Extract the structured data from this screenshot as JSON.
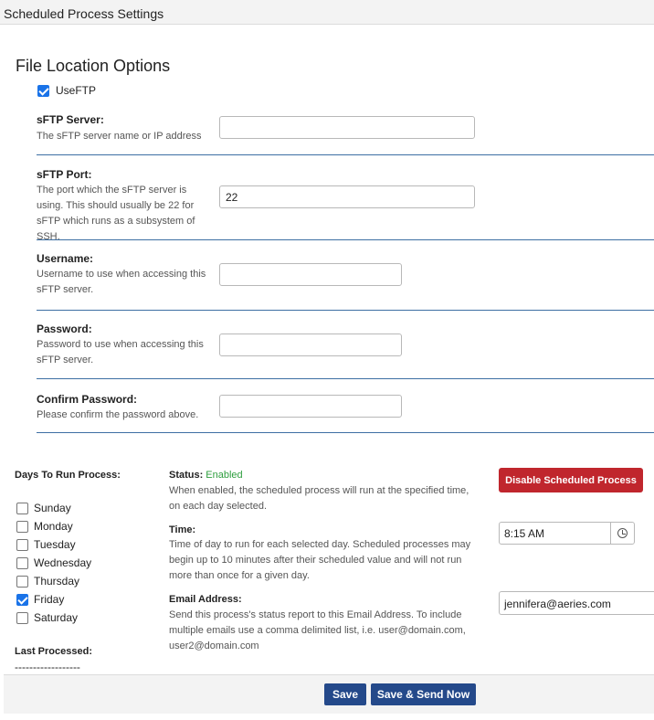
{
  "window": {
    "title": "Scheduled Process Settings"
  },
  "file_location": {
    "heading": "File Location Options",
    "use_ftp": {
      "label": "UseFTP",
      "checked": true
    },
    "fields": [
      {
        "label": "sFTP Server:",
        "description": "The sFTP server name or IP address",
        "value": ""
      },
      {
        "label": "sFTP Port:",
        "description": "The port which the sFTP server is using. This should usually be 22 for sFTP which runs as a subsystem of SSH.",
        "value": "22"
      },
      {
        "label": "Username:",
        "description": "Username to use when accessing this sFTP server.",
        "value": ""
      },
      {
        "label": "Password:",
        "description": "Password to use when accessing this sFTP server.",
        "value": ""
      },
      {
        "label": "Confirm Password:",
        "description": "Please confirm the password above.",
        "value": ""
      }
    ]
  },
  "schedule": {
    "days_title": "Days To Run Process:",
    "days": [
      {
        "label": "Sunday",
        "checked": false
      },
      {
        "label": "Monday",
        "checked": false
      },
      {
        "label": "Tuesday",
        "checked": false
      },
      {
        "label": "Wednesday",
        "checked": false
      },
      {
        "label": "Thursday",
        "checked": false
      },
      {
        "label": "Friday",
        "checked": true
      },
      {
        "label": "Saturday",
        "checked": false
      }
    ],
    "last_processed_title": "Last Processed:",
    "last_processed_value": "------------------",
    "status": {
      "label": "Status:",
      "value": "Enabled",
      "description": "When enabled, the scheduled process will run at the specified time, on each day selected."
    },
    "disable_button": "Disable Scheduled Process",
    "time": {
      "label": "Time:",
      "description": "Time of day to run for each selected day. Scheduled processes may begin up to 10 minutes after their scheduled value and will not run more than once for a given day.",
      "value": "8:15 AM",
      "icon": "clock-icon"
    },
    "email": {
      "label": "Email Address:",
      "description": "Send this process's status report to this Email Address. To include multiple emails use a comma delimited list, i.e. user@domain.com, user2@domain.com",
      "value": "jennifera@aeries.com"
    }
  },
  "footer": {
    "save_label": "Save",
    "save_send_label": "Save & Send Now"
  },
  "colors": {
    "enabled_green": "#2e9e3e",
    "disable_red": "#c0262d",
    "button_blue": "#24498a",
    "divider_blue": "#3d6fa3"
  }
}
